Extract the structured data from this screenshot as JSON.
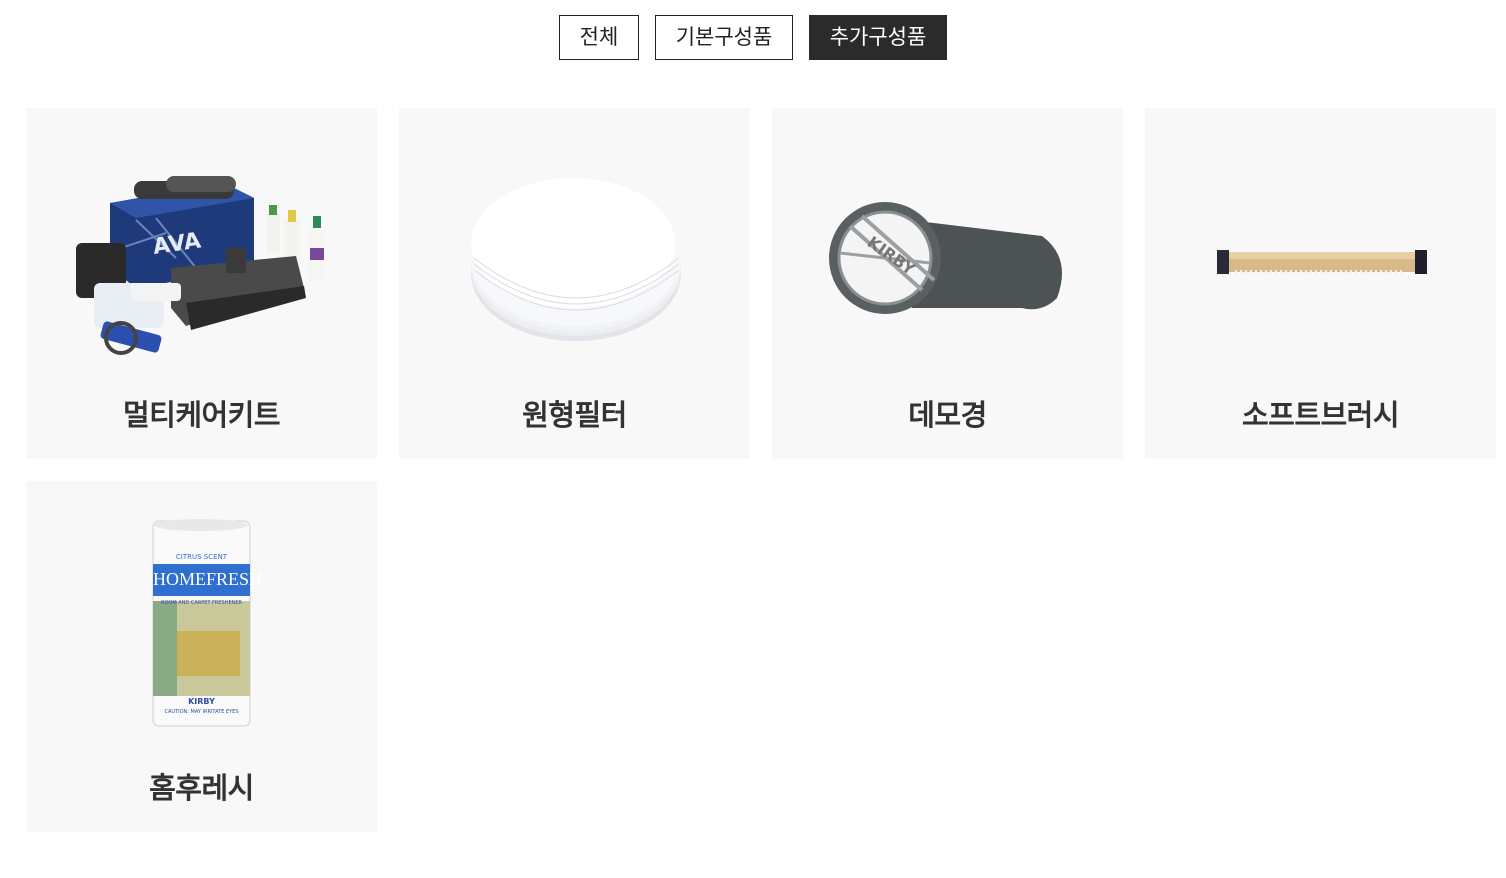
{
  "tabs": [
    {
      "label": "전체",
      "active": false
    },
    {
      "label": "기본구성품",
      "active": false
    },
    {
      "label": "추가구성품",
      "active": true
    }
  ],
  "products": [
    {
      "name": "멀티케어키트",
      "image": "multicare-kit-image"
    },
    {
      "name": "원형필터",
      "image": "round-filter-image"
    },
    {
      "name": "데모경",
      "image": "demo-scope-image"
    },
    {
      "name": "소프트브러시",
      "image": "soft-brush-image"
    },
    {
      "name": "홈후레시",
      "image": "homefresh-can-image",
      "can_text": {
        "scent": "CITRUS SCENT",
        "brand_line1": "HOME",
        "brand_line2": "FRESH",
        "subtitle": "ROOM AND CARPET FRESHENER",
        "maker": "KIRBY",
        "caution": "CAUTION: MAY IRRITATE EYES"
      }
    }
  ],
  "colors": {
    "active_tab": "#2b2b2b",
    "card_bg": "#f8f8f8",
    "text": "#333333"
  }
}
